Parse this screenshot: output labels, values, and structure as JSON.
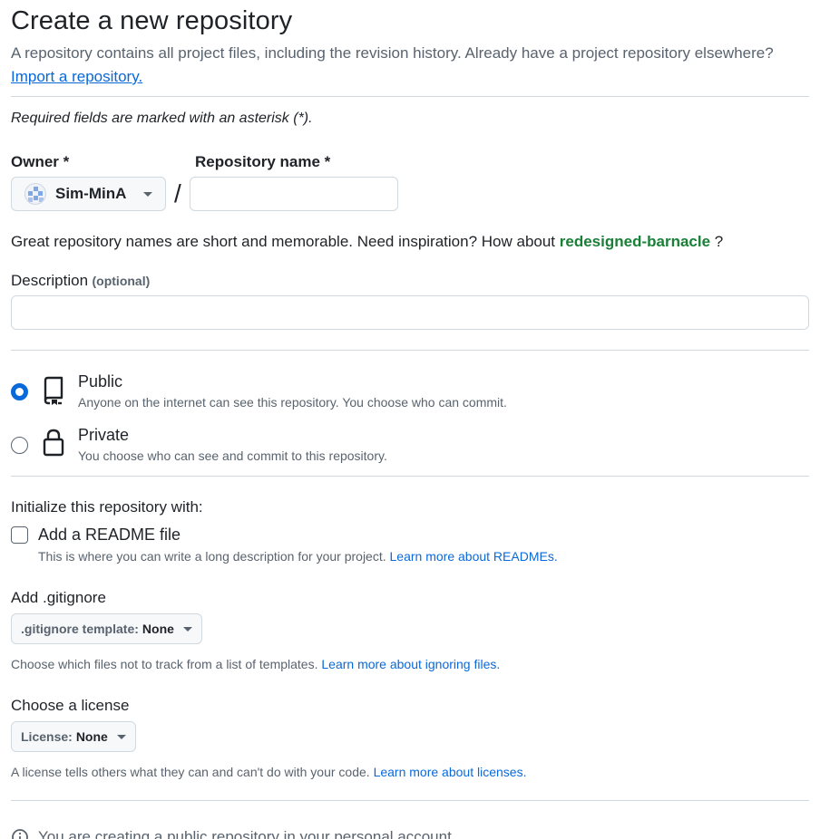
{
  "page": {
    "title": "Create a new repository",
    "intro": "A repository contains all project files, including the revision history. Already have a project repository elsewhere?",
    "import_link": "Import a repository.",
    "required_note": "Required fields are marked with an asterisk (*)."
  },
  "owner": {
    "label": "Owner *",
    "name": "Sim-MinA"
  },
  "repo_name": {
    "label": "Repository name *",
    "value": "",
    "placeholder": ""
  },
  "suggestion": {
    "text": "Great repository names are short and memorable. Need inspiration? How about",
    "name": "redesigned-barnacle",
    "suffix": "?"
  },
  "description": {
    "label": "Description",
    "optional": "(optional)",
    "value": ""
  },
  "visibility": {
    "selected": "public",
    "options": [
      {
        "id": "public",
        "title": "Public",
        "desc": "Anyone on the internet can see this repository. You choose who can commit."
      },
      {
        "id": "private",
        "title": "Private",
        "desc": "You choose who can see and commit to this repository."
      }
    ]
  },
  "initialize": {
    "heading": "Initialize this repository with:",
    "readme_label": "Add a README file",
    "readme_desc": "This is where you can write a long description for your project.",
    "readme_link": "Learn more about READMEs."
  },
  "gitignore": {
    "heading": "Add .gitignore",
    "select_prefix": ".gitignore template:",
    "select_value": "None",
    "desc": "Choose which files not to track from a list of templates.",
    "link": "Learn more about ignoring files."
  },
  "license": {
    "heading": "Choose a license",
    "select_prefix": "License:",
    "select_value": "None",
    "desc": "A license tells others what they can and can't do with your code.",
    "link": "Learn more about licenses."
  },
  "footer_note": "You are creating a public repository in your personal account.",
  "colors": {
    "accent": "#0969da",
    "success": "#1a7f37",
    "muted": "#59636e",
    "border": "#d1d9e0"
  }
}
